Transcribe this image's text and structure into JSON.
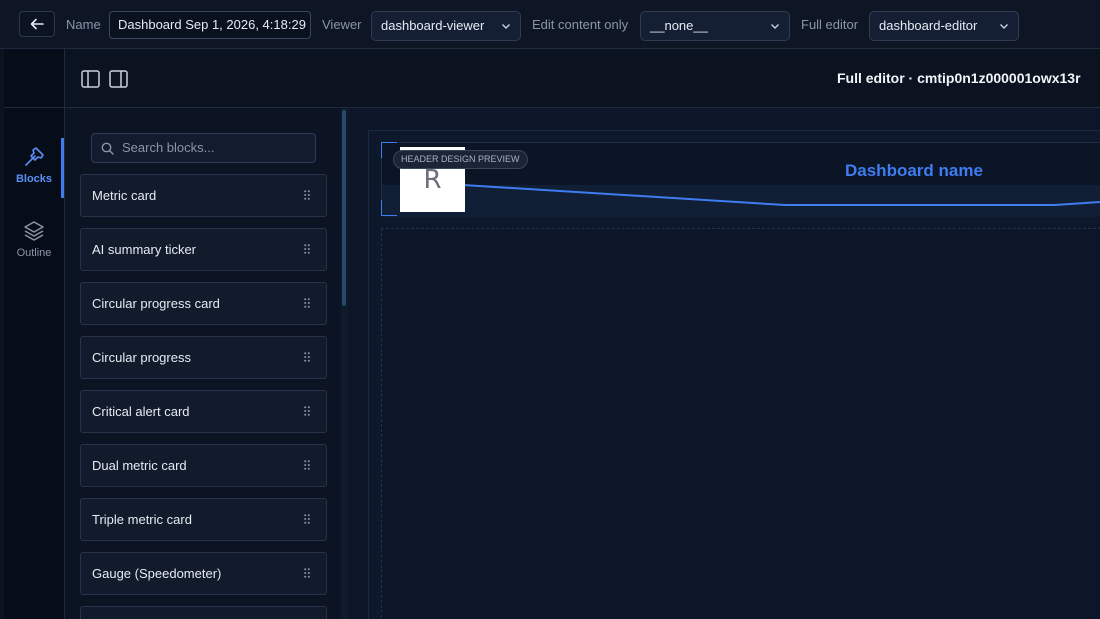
{
  "topbar": {
    "name_label": "Name",
    "name_value": "Dashboard Sep 1, 2026, 4:18:29",
    "viewer_label": "Viewer",
    "viewer_value": "dashboard-viewer",
    "edit_label": "Edit content only",
    "edit_value": "__none__",
    "full_label": "Full editor",
    "full_value": "dashboard-editor"
  },
  "rail": {
    "items": [
      {
        "label": "Blocks",
        "icon": "hammer-icon",
        "active": true
      },
      {
        "label": "Outline",
        "icon": "layers-icon",
        "active": false
      }
    ]
  },
  "header": {
    "title": "Full editor · cmtip0n1z000001owx13r"
  },
  "blocks": {
    "search_placeholder": "Search blocks...",
    "items": [
      "Metric card",
      "AI summary ticker",
      "Circular progress card",
      "Circular progress",
      "Critical alert card",
      "Dual metric card",
      "Triple metric card",
      "Gauge (Speedometer)",
      ""
    ]
  },
  "canvas": {
    "badge": "HEADER DESIGN PREVIEW",
    "logo_letter": "R",
    "dashboard_name": "Dashboard name"
  },
  "colors": {
    "accent": "#3e7cf0",
    "background": "#0b1220",
    "panel": "#0c1423"
  }
}
